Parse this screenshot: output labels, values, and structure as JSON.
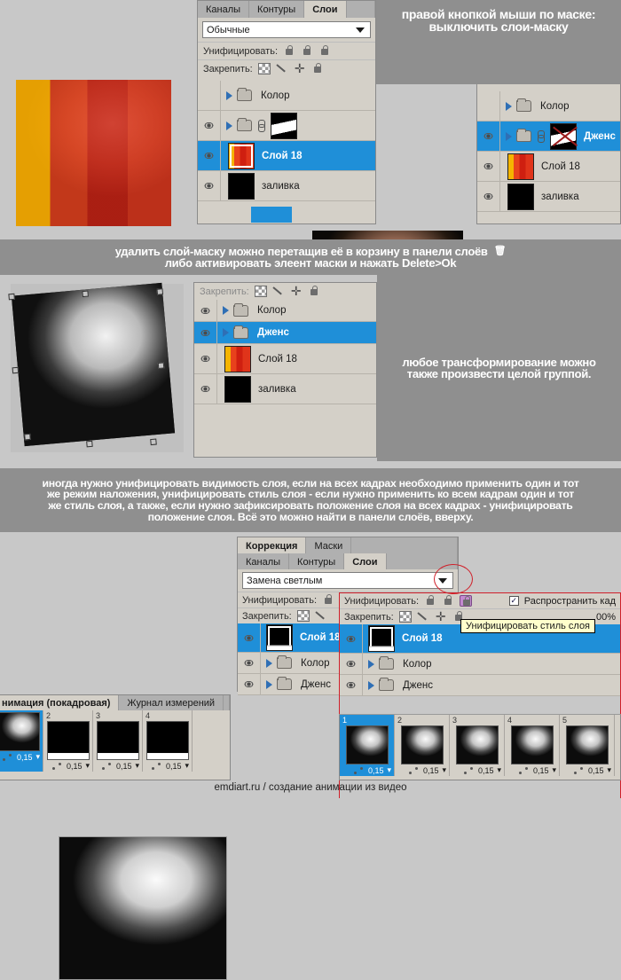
{
  "sections": {
    "s1": {
      "panel": {
        "tabs": [
          {
            "label": "Каналы",
            "active": false
          },
          {
            "label": "Контуры",
            "active": false
          },
          {
            "label": "Слои",
            "active": true
          }
        ],
        "blend_mode": "Обычные",
        "unify_label": "Унифицировать:",
        "lock_label": "Закрепить:",
        "layers": [
          {
            "name": "Колор",
            "type": "group",
            "visible": false,
            "selected": false
          },
          {
            "name": "",
            "type": "group-mask",
            "visible": true,
            "selected": false
          },
          {
            "name": "Слой 18",
            "type": "image",
            "visible": true,
            "selected": true
          },
          {
            "name": "заливка",
            "type": "fill",
            "visible": true,
            "selected": false
          }
        ]
      },
      "right_panel": {
        "layers": [
          {
            "name": "Колор",
            "type": "group",
            "visible": false,
            "selected": false
          },
          {
            "name": "Дженс",
            "type": "group-mask-disabled",
            "visible": true,
            "selected": true
          },
          {
            "name": "Слой 18",
            "type": "image",
            "visible": true,
            "selected": false
          },
          {
            "name": "заливка",
            "type": "fill",
            "visible": true,
            "selected": false
          }
        ]
      },
      "caption": {
        "line1": "правой кнопкой мыши по маске:",
        "line2": "выключить слои-маску"
      }
    },
    "band1": {
      "line1": "удалить слой-маску  можно перетащив её в корзину в панели слоёв",
      "trash_icon": "trash-icon",
      "line2": "либо активировать элеент маски и нажать Delete>Ok"
    },
    "s2": {
      "panel": {
        "lock_label": "Закрепить:",
        "layers": [
          {
            "name": "Колор",
            "type": "group",
            "visible": true,
            "selected": false
          },
          {
            "name": "Дженс",
            "type": "group",
            "visible": true,
            "selected": true
          },
          {
            "name": "Слой 18",
            "type": "image",
            "visible": true,
            "selected": false
          },
          {
            "name": "заливка",
            "type": "fill",
            "visible": true,
            "selected": false
          }
        ]
      },
      "caption": {
        "line1": "любое трансформирование можно",
        "line2": "также произвести целой группой."
      }
    },
    "band2": {
      "line1": "иногда нужно унифицировать видимость слоя, если на всех кадрах необходимо применить один и тот",
      "line2": "же режим наложения, унифицировать стиль слоя - если  нужно применить ко всем кадрам один  и тот",
      "line3": "же стиль слоя,  а также, если нужно зафиксировать положение слоя на всех кадрах - унифицировать",
      "line4": "положение слоя. Всё это можно найти в панели слоёв, вверху."
    },
    "s3": {
      "top_tabs": [
        {
          "label": "Коррекция",
          "active": true
        },
        {
          "label": "Маски",
          "active": false
        }
      ],
      "tabs": [
        {
          "label": "Каналы",
          "active": false
        },
        {
          "label": "Контуры",
          "active": false
        },
        {
          "label": "Слои",
          "active": true
        }
      ],
      "blend_mode": "Замена светлым",
      "unify_label": "Унифицировать:",
      "lock_label": "Закрепить:",
      "propagate_label": "Распространить кад",
      "opacity_value": "00%",
      "tooltip": "Унифицировать стиль слоя",
      "layers_left": [
        {
          "name": "Слой 18",
          "type": "mask",
          "visible": true,
          "selected": true
        },
        {
          "name": "Колор",
          "type": "group",
          "visible": true,
          "selected": false
        },
        {
          "name": "Дженс",
          "type": "group",
          "visible": true,
          "selected": false
        }
      ],
      "layers_right": [
        {
          "name": "Слой 18",
          "type": "mask",
          "visible": true,
          "selected": true
        },
        {
          "name": "Колор",
          "type": "group",
          "visible": true,
          "selected": false
        },
        {
          "name": "Дженс",
          "type": "group",
          "visible": true,
          "selected": false
        }
      ]
    },
    "anim_left": {
      "tabs": [
        {
          "label": "нимация (покадровая)",
          "active": true
        },
        {
          "label": "Журнал измерений",
          "active": false
        }
      ],
      "frames": [
        {
          "num": "",
          "delay": "0,15",
          "selected": true,
          "kind": "portrait"
        },
        {
          "num": "2",
          "delay": "0,15",
          "selected": false,
          "kind": "black"
        },
        {
          "num": "3",
          "delay": "0,15",
          "selected": false,
          "kind": "black"
        },
        {
          "num": "4",
          "delay": "0,15",
          "selected": false,
          "kind": "black"
        }
      ]
    },
    "anim_right": {
      "frames": [
        {
          "num": "1",
          "delay": "0,15",
          "selected": true,
          "kind": "portrait"
        },
        {
          "num": "2",
          "delay": "0,15",
          "selected": false,
          "kind": "portrait"
        },
        {
          "num": "3",
          "delay": "0,15",
          "selected": false,
          "kind": "portrait"
        },
        {
          "num": "4",
          "delay": "0,15",
          "selected": false,
          "kind": "portrait"
        },
        {
          "num": "5",
          "delay": "0,15",
          "selected": false,
          "kind": "portrait"
        }
      ]
    },
    "footer": "emdiart.ru / создание анимации из видео"
  },
  "colors": {
    "selection_blue": "#1f8fd8",
    "panel_gray": "#d4d0c8",
    "band_gray": "#8f8f8f",
    "annotation_red": "#d0202a",
    "tooltip_yellow": "#ffffcc"
  }
}
